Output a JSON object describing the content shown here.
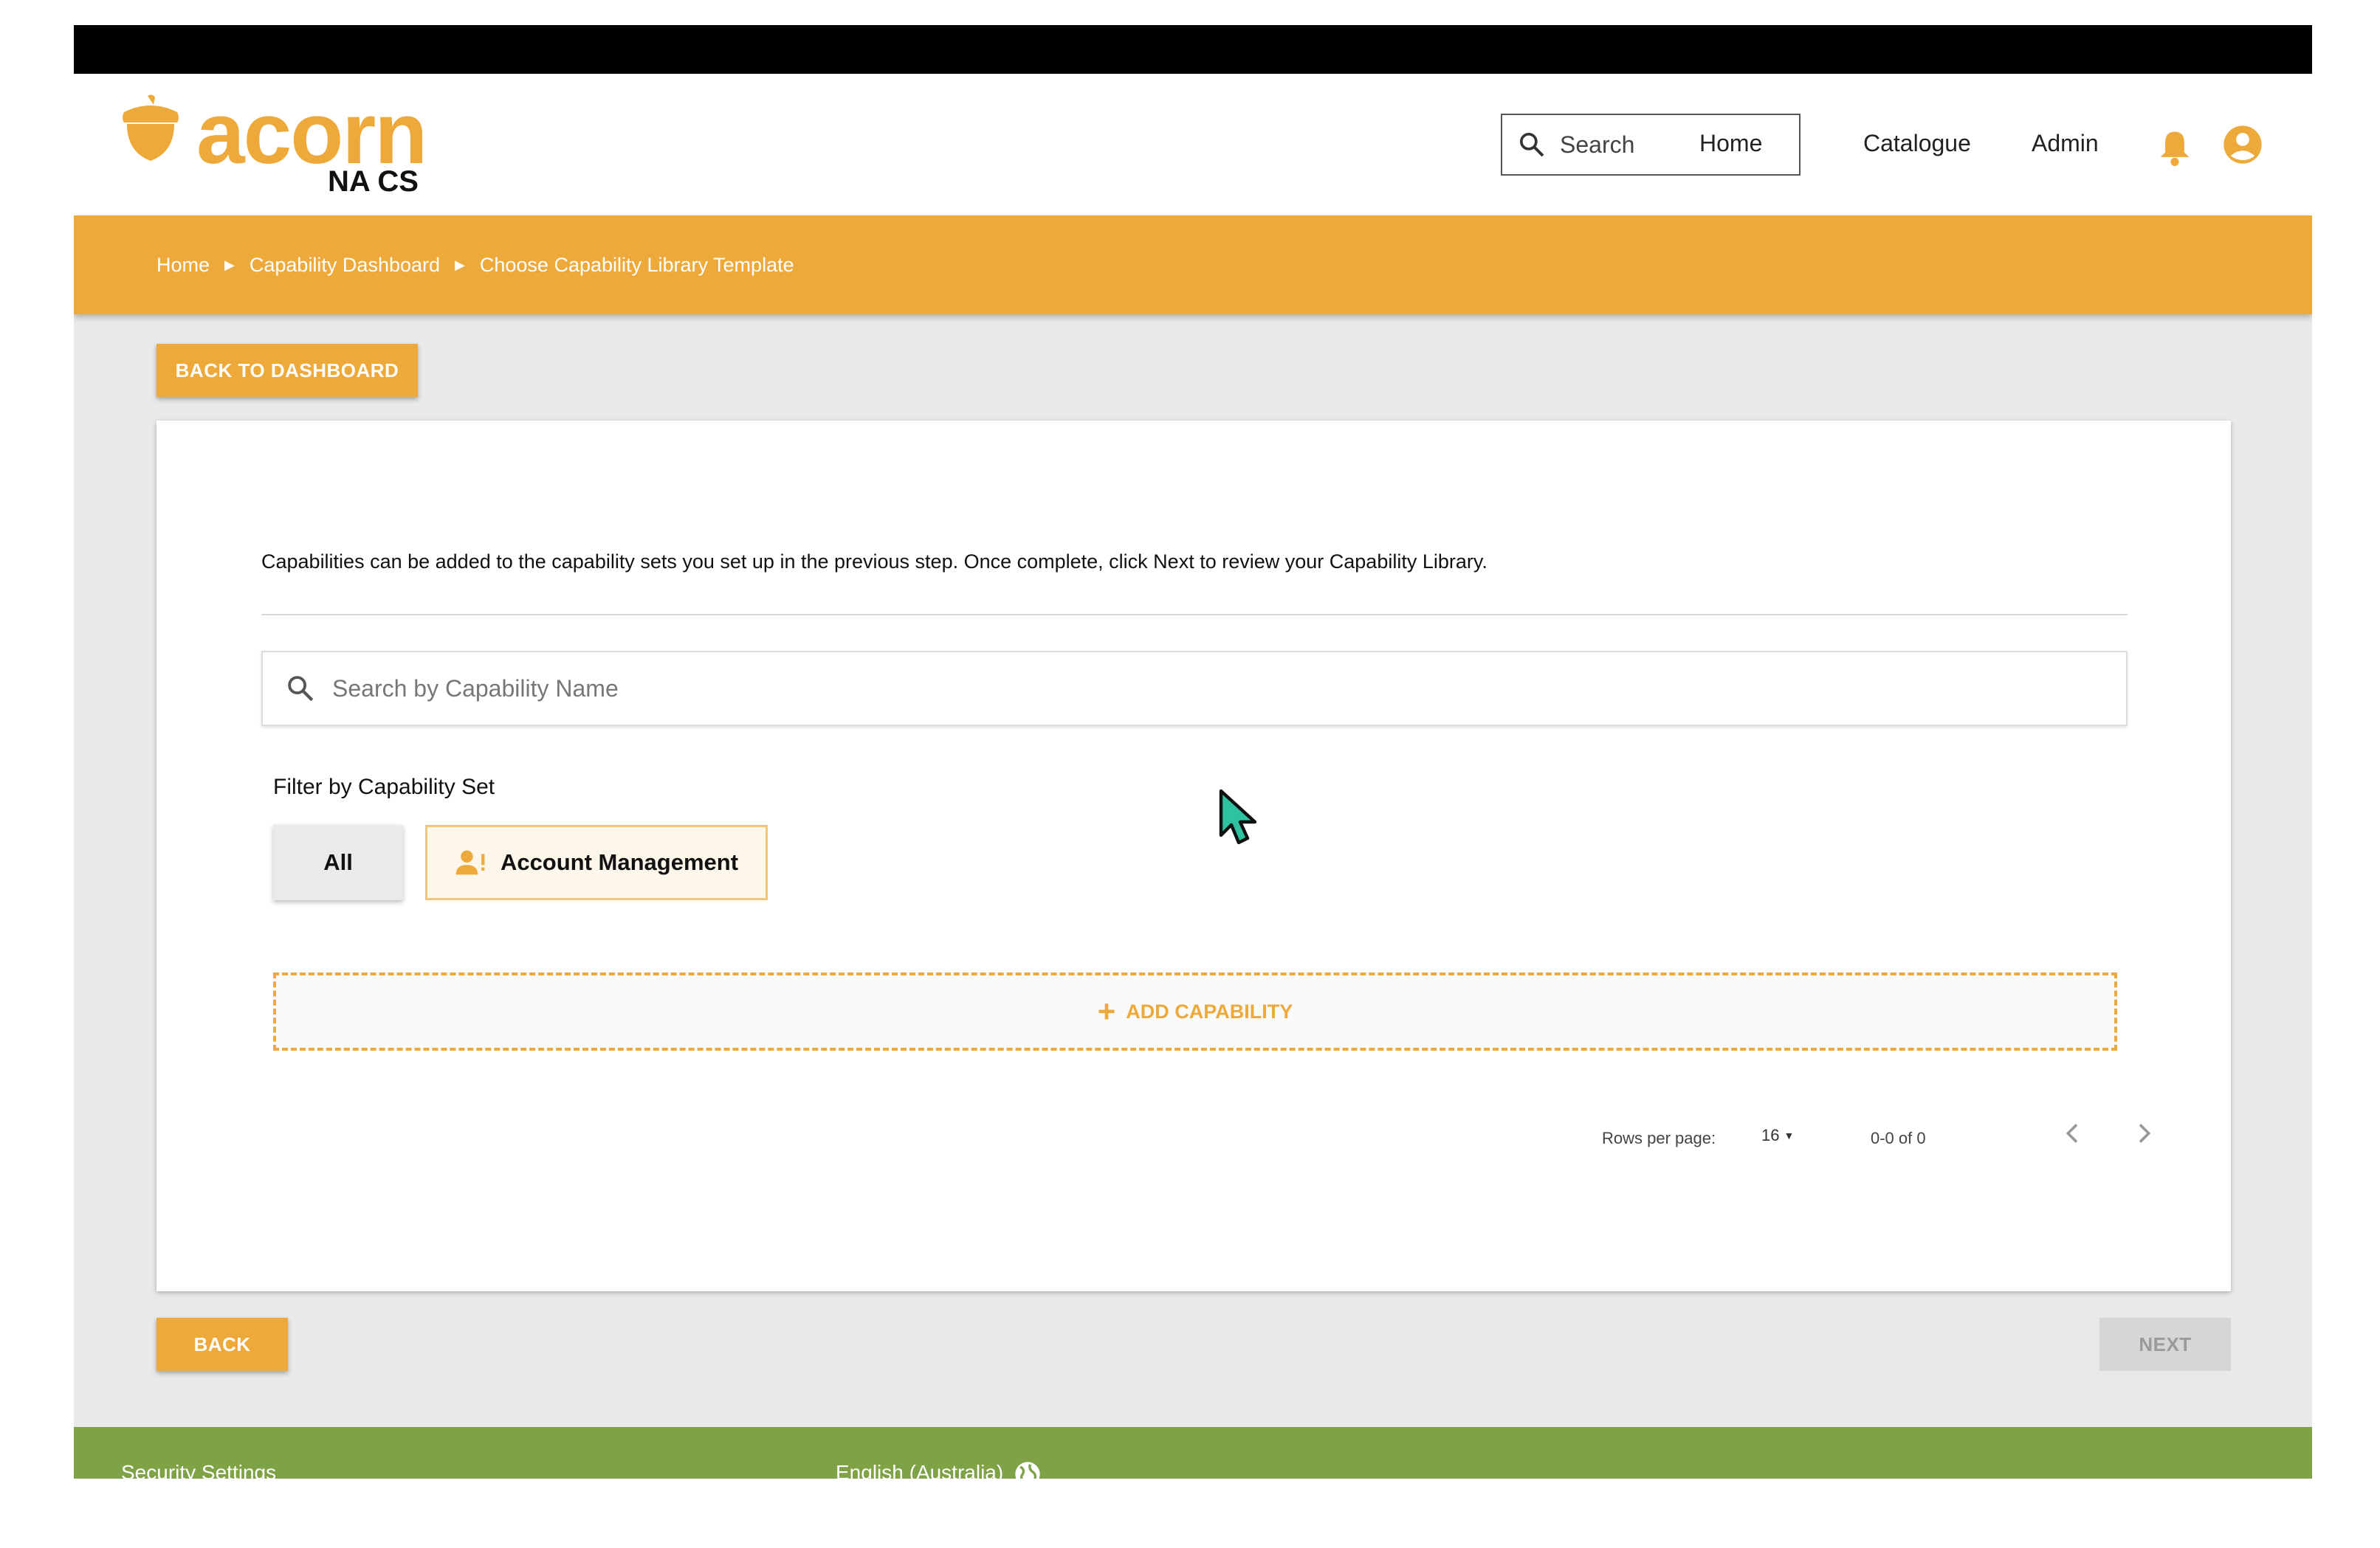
{
  "app": {
    "brand": "acorn",
    "brand_sub": "NA CS",
    "brand_color": "#eea93b"
  },
  "header": {
    "search_placeholder": "Search",
    "nav": [
      "Home",
      "Catalogue",
      "Admin"
    ],
    "icons": [
      "search-icon",
      "bell-icon",
      "account-circle-icon"
    ]
  },
  "breadcrumb": {
    "items": [
      "Home",
      "Capability Dashboard",
      "Choose Capability Library Template"
    ]
  },
  "actions": {
    "back_to_dashboard": "BACK TO DASHBOARD",
    "back": "BACK",
    "next": "NEXT"
  },
  "main": {
    "intro": "Capabilities can be added to the capability sets you set up in the previous step. Once complete, click Next to review your Capability Library.",
    "search_placeholder": "Search by Capability Name",
    "filter_label": "Filter by Capability Set",
    "filters": [
      "All",
      "Account Management"
    ],
    "add_capability": "ADD CAPABILITY"
  },
  "pagination": {
    "rows_label": "Rows per page:",
    "rows_value": "16",
    "range": "0-0 of 0"
  },
  "footer": {
    "security": "Security Settings",
    "language": "English (Australia)",
    "color": "#7fa246"
  }
}
